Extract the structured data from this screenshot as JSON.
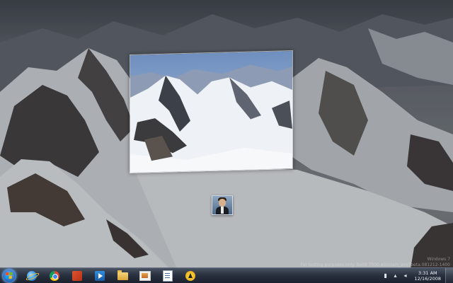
{
  "watermark": {
    "line1": "Windows 7",
    "line2": "For testing purposes only. Build 7000.winmain_win7beta.081212-1400"
  },
  "taskbar": {
    "start_label": "Start",
    "items": [
      {
        "name": "internet-explorer",
        "icon": "ie-icon"
      },
      {
        "name": "google-chrome",
        "icon": "chrome-icon"
      },
      {
        "name": "office",
        "icon": "office-icon"
      },
      {
        "name": "media-player",
        "icon": "media-player-icon"
      },
      {
        "name": "windows-explorer",
        "icon": "folder-icon"
      },
      {
        "name": "pictures",
        "icon": "pictures-icon"
      },
      {
        "name": "document",
        "icon": "document-icon"
      },
      {
        "name": "security",
        "icon": "shield-icon"
      }
    ]
  },
  "tray": {
    "network_icon": "network-icon",
    "volume_icon": "volume-icon",
    "time": "3:31 AM",
    "date": "12/16/2008"
  },
  "colors": {
    "taskbar": "#242c3a",
    "start_orb": "#2d6fc2"
  }
}
